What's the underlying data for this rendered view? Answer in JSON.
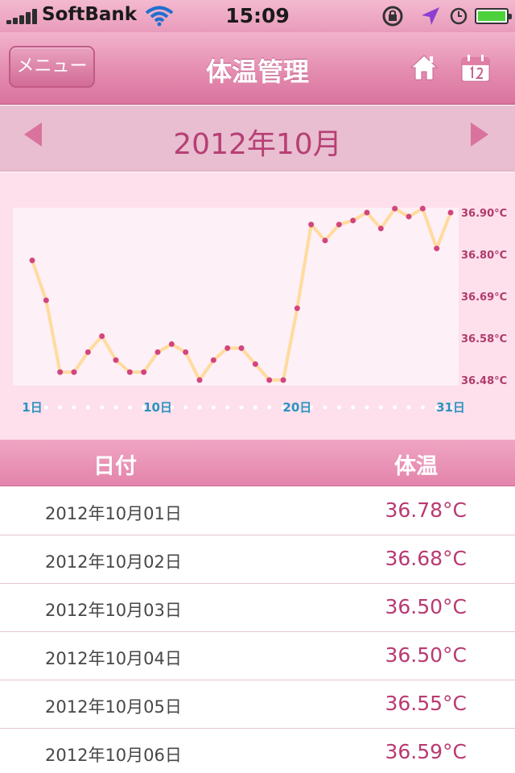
{
  "status_bar": {
    "carrier": "SoftBank",
    "time": "15:09",
    "icons": [
      "signal-icon",
      "wifi-icon",
      "rotation-lock-icon",
      "location-icon",
      "alarm-icon",
      "battery-icon"
    ]
  },
  "nav": {
    "menu_label": "メニュー",
    "title": "体温管理",
    "icons": [
      "home-icon",
      "calendar-icon"
    ]
  },
  "month": {
    "label": "2012年10月"
  },
  "chart_data": {
    "type": "line",
    "x": [
      1,
      2,
      3,
      4,
      5,
      6,
      7,
      8,
      9,
      10,
      11,
      12,
      13,
      14,
      15,
      16,
      17,
      18,
      19,
      20,
      21,
      22,
      23,
      24,
      25,
      26,
      27,
      28,
      29,
      30,
      31
    ],
    "x_tick_labels": [
      {
        "day": 1,
        "label": "1日"
      },
      {
        "day": 10,
        "label": "10日"
      },
      {
        "day": 20,
        "label": "20日"
      },
      {
        "day": 31,
        "label": "31日"
      }
    ],
    "series": [
      {
        "values": [
          36.78,
          36.68,
          36.5,
          36.5,
          36.55,
          36.59,
          36.53,
          36.5,
          36.5,
          36.55,
          36.57,
          36.55,
          36.48,
          36.53,
          36.56,
          36.56,
          36.52,
          36.48,
          36.48,
          36.66,
          36.87,
          36.83,
          36.87,
          36.88,
          36.9,
          36.86,
          36.91,
          36.89,
          36.91,
          36.81,
          36.9
        ],
        "color": "#ffdb9e",
        "marker_color": "#d2457f"
      }
    ],
    "y_tick_labels": [
      "36.90°C",
      "36.80°C",
      "36.69°C",
      "36.58°C",
      "36.48°C"
    ],
    "ylim": [
      36.48,
      36.9
    ],
    "xlim": [
      1,
      31
    ],
    "grid": false,
    "background_color": "#fdf0f7"
  },
  "table": {
    "header_date": "日付",
    "header_temp": "体温",
    "rows": [
      {
        "date": "2012年10月01日",
        "temp": "36.78°C"
      },
      {
        "date": "2012年10月02日",
        "temp": "36.68°C"
      },
      {
        "date": "2012年10月03日",
        "temp": "36.50°C"
      },
      {
        "date": "2012年10月04日",
        "temp": "36.50°C"
      },
      {
        "date": "2012年10月05日",
        "temp": "36.55°C"
      },
      {
        "date": "2012年10月06日",
        "temp": "36.59°C"
      }
    ]
  },
  "colors": {
    "accent": "#d9739e",
    "temp_text": "#b93a72",
    "month_text": "#b73f74",
    "axis_day_text": "#2c92bf"
  }
}
